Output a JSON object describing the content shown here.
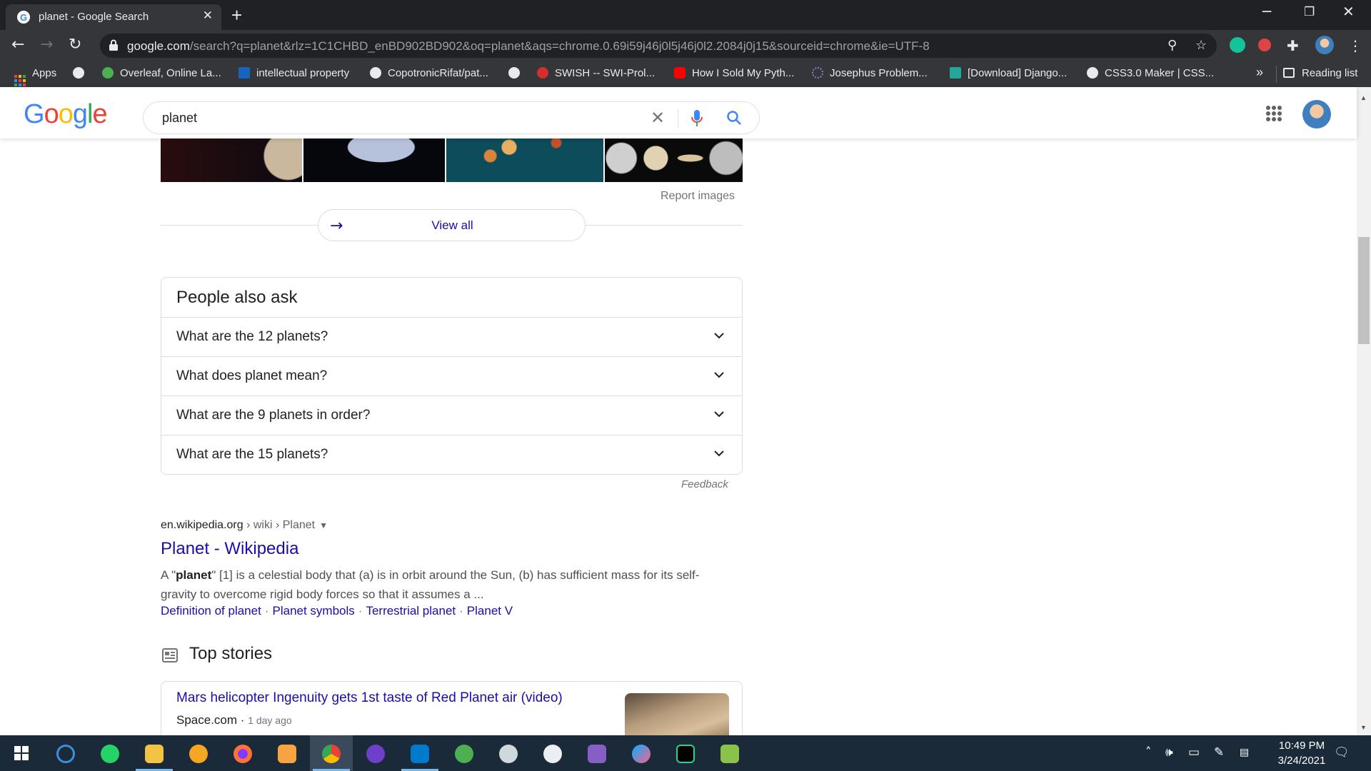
{
  "browser": {
    "tab_title": "planet - Google Search",
    "tab_close": "✕",
    "new_tab": "+",
    "url_host": "google.com",
    "url_rest": "/search?q=planet&rlz=1C1CHBD_enBD902BD902&oq=planet&aqs=chrome.0.69i59j46j0l5j46j0l2.2084j0j15&sourceid=chrome&ie=UTF-8",
    "reading_list": "Reading list",
    "bookmarks_overflow": "»",
    "bookmarks": [
      {
        "label": "Apps",
        "color": "#ea4335"
      },
      {
        "label": "",
        "color": "#e8eaed"
      },
      {
        "label": "Overleaf, Online La...",
        "color": "#4caf50"
      },
      {
        "label": "intellectual property",
        "color": "#1565c0"
      },
      {
        "label": "CopotronicRifat/pat...",
        "color": "#e8eaed"
      },
      {
        "label": "",
        "color": "#e8eaed"
      },
      {
        "label": "SWISH -- SWI-Prol...",
        "color": "#d32f2f"
      },
      {
        "label": "How I Sold My Pyth...",
        "color": "#ff0000"
      },
      {
        "label": "Josephus Problem...",
        "color": "#3f51b5"
      },
      {
        "label": "[Download] Django...",
        "color": "#26a69a"
      },
      {
        "label": "CSS3.0 Maker | CSS...",
        "color": "#e8eaed"
      }
    ]
  },
  "google": {
    "logo_letters": [
      "G",
      "o",
      "o",
      "g",
      "l",
      "e"
    ],
    "logo_colors": [
      "#4285f4",
      "#ea4335",
      "#fbbc05",
      "#4285f4",
      "#34a853",
      "#ea4335"
    ],
    "query": "planet",
    "clear": "✕"
  },
  "images": {
    "report": "Report images",
    "view_all": "View all",
    "arrow": "→"
  },
  "paa": {
    "title": "People also ask",
    "questions": [
      "What are the 12 planets?",
      "What does planet mean?",
      "What are the 9 planets in order?",
      "What are the 15 planets?"
    ],
    "feedback": "Feedback"
  },
  "result": {
    "domain": "en.wikipedia.org",
    "path": " › wiki › Planet",
    "title": "Planet - Wikipedia",
    "snippet_pre": "A \"",
    "snippet_bold": "planet",
    "snippet_post": "\" [1] is a celestial body that (a) is in orbit around the Sun, (b) has sufficient mass for its self-gravity to overcome rigid body forces so that it assumes a ...",
    "sitelinks": [
      "Definition of planet",
      "Planet symbols",
      "Terrestrial planet",
      "Planet V"
    ],
    "separator": "·"
  },
  "top_stories": {
    "title": "Top stories",
    "story_title": "Mars helicopter Ingenuity gets 1st taste of Red Planet air (video)",
    "source": "Space.com",
    "age": "1 day ago"
  },
  "taskbar": {
    "time": "10:49 PM",
    "date": "3/24/2021"
  }
}
